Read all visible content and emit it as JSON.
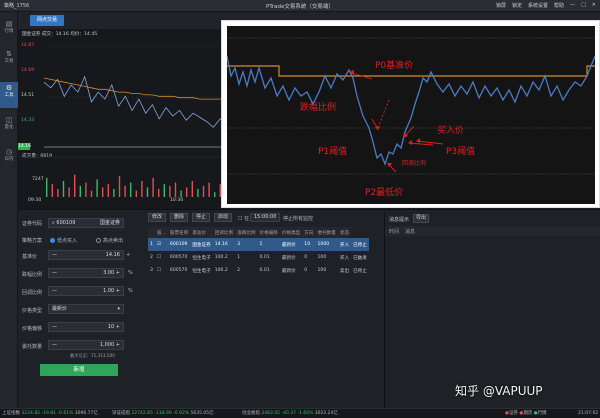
{
  "titlebar": {
    "account": "策略_1756",
    "title": "PTrade交易系统（交易端）",
    "controls": [
      "锁屏",
      "锁定",
      "系统设置",
      "帮助"
    ]
  },
  "sidebar": {
    "items": [
      {
        "label": "行情",
        "icon": "quote-icon"
      },
      {
        "label": "交易",
        "icon": "trade-icon"
      },
      {
        "label": "工具",
        "icon": "tool-icon"
      },
      {
        "label": "量化",
        "icon": "quant-icon"
      },
      {
        "label": "日内",
        "icon": "intraday-icon"
      }
    ],
    "active": 2
  },
  "tab": {
    "label": "网点交易"
  },
  "chart": {
    "header": "国金证券  成交：14.16  均价：14.45",
    "prices": [
      "14.87",
      "14.69",
      "14.51",
      "14.33",
      "14.16"
    ],
    "volume_label": "成交量：6819",
    "volume_tick": "7247",
    "times": [
      "09:30",
      "10:30"
    ]
  },
  "chart_data": {
    "type": "line",
    "series": [
      {
        "name": "成交",
        "values": [
          14.62,
          14.58,
          14.64,
          14.52,
          14.6,
          14.55,
          14.66,
          14.48,
          14.55,
          14.5,
          14.6,
          14.45,
          14.52,
          14.42,
          14.5,
          14.4,
          14.46,
          14.36,
          14.44,
          14.38,
          14.42,
          14.35,
          14.4,
          14.37,
          14.34,
          14.3,
          14.36,
          14.33
        ]
      },
      {
        "name": "均价",
        "values": [
          14.65,
          14.64,
          14.63,
          14.62,
          14.61,
          14.6,
          14.59,
          14.58,
          14.57,
          14.57,
          14.56,
          14.55,
          14.55,
          14.54,
          14.54,
          14.53,
          14.53,
          14.52,
          14.52,
          14.52,
          14.51,
          14.51,
          14.51,
          14.5,
          14.5,
          14.5,
          14.5,
          14.5
        ]
      }
    ],
    "ylim": [
      14.16,
      14.87
    ]
  },
  "form": {
    "code_label": "证券代码",
    "code_value": "600109",
    "code_name": "国金证券",
    "direction_label": "策略方案",
    "dir_buy": "低点买入",
    "dir_sell": "高点卖出",
    "base_label": "基准价",
    "base_value": "14.16",
    "fall_label": "跌幅比例",
    "fall_value": "3.00",
    "rebound_label": "回调比例",
    "rebound_value": "1.00",
    "ptype_label": "价格类型",
    "ptype_value": "最新价",
    "poffset_label": "价格偏移",
    "poffset_value": "10",
    "qty_label": "委托数量",
    "qty_value": "1,000",
    "max_qty": "最大可买：71,313,500",
    "submit": "新增"
  },
  "toolbar": {
    "buttons": [
      "修改",
      "删除",
      "停止",
      "启动"
    ],
    "cb_label": "在",
    "time": "15:00:00",
    "time_suffix": "停止所有监控"
  },
  "table": {
    "headers": [
      "",
      "股...",
      "股票名称",
      "基准价",
      "回调比例",
      "涨跌比例",
      "价格偏移",
      "价格类型",
      "方向",
      "委托数量",
      "状态"
    ],
    "rows": [
      [
        "1",
        "600109",
        "国金证券",
        "14.16",
        "3",
        "1",
        "最新价",
        "10",
        "1000",
        "买入",
        "已停止"
      ],
      [
        "2",
        "600570",
        "恒生电子",
        "100.2",
        "1",
        "0.01",
        "最新价",
        "0",
        "100",
        "买入",
        "已触发"
      ],
      [
        "3",
        "600570",
        "恒生电子",
        "100.2",
        "2",
        "0.01",
        "最新价",
        "0",
        "100",
        "卖出",
        "已停止"
      ]
    ]
  },
  "messages": {
    "title": "消息提示",
    "export": "导出",
    "cols": [
      "时间",
      "消息"
    ]
  },
  "status": {
    "sh_label": "上证指数",
    "sh_value": "3234.82",
    "sh_chg": "-19.81",
    "sh_pct": "-0.61%",
    "sh_amt": "3096.77亿",
    "sz_label": "深证成指",
    "sz_value": "12742.85",
    "sz_chg": "-118.90",
    "sz_pct": "-0.92%",
    "sz_amt": "5635.05亿",
    "cy_label": "创业板指",
    "cy_value": "2483.05",
    "cy_chg": "-40.37",
    "cy_pct": "-1.60%",
    "cy_amt": "3022.24亿",
    "right": [
      "证券",
      "期货",
      "行情"
    ],
    "time": "21:07:02"
  },
  "inset": {
    "labels": {
      "p0": "P0基准价",
      "fall": "跌幅比例",
      "buy": "买入价",
      "p1": "P1阈值",
      "p3": "P3阈值",
      "rebound": "回调比例",
      "p2": "P2最低价"
    },
    "accent": "#e02020"
  },
  "watermark": "知乎 @VAPUUP"
}
